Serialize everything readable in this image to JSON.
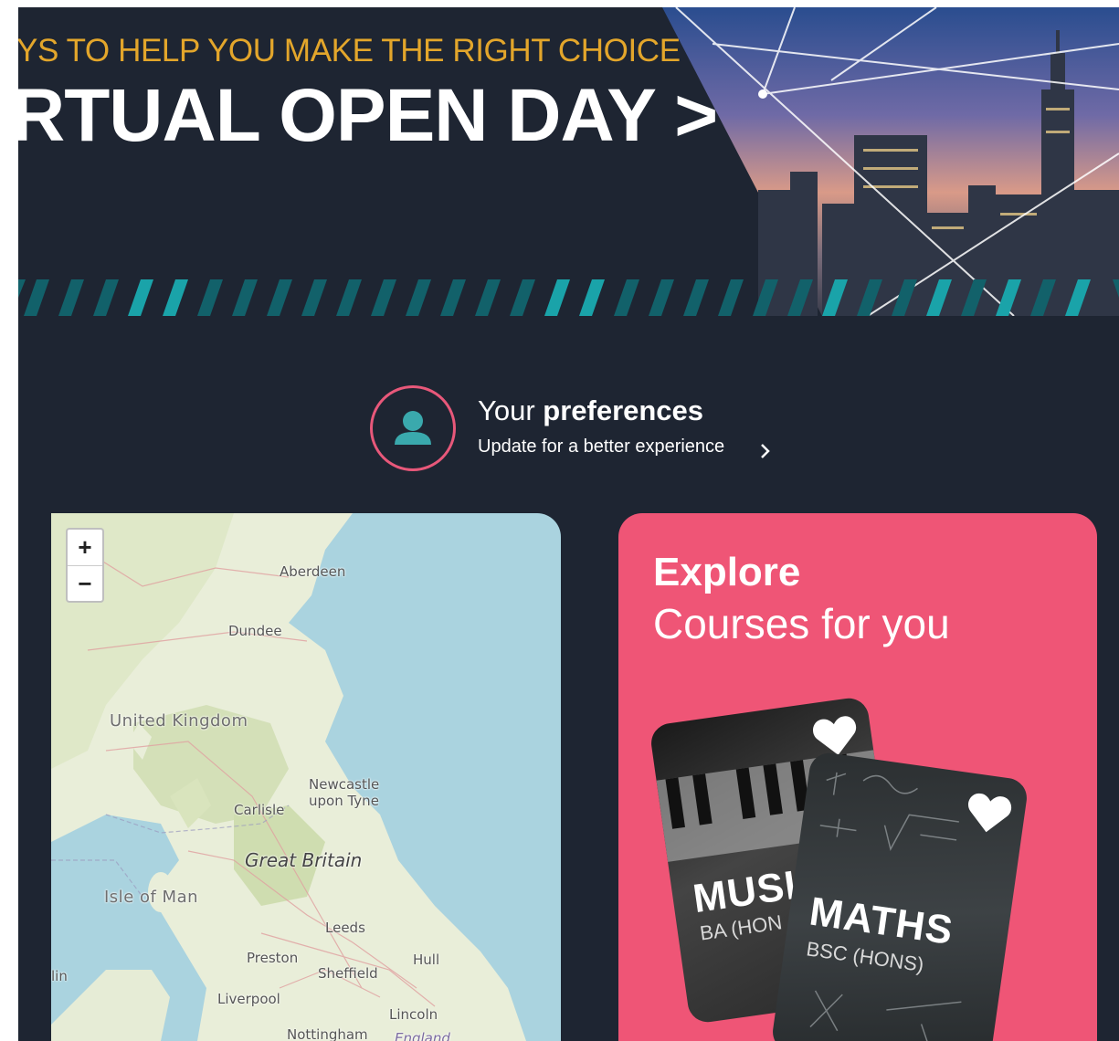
{
  "banner": {
    "tagline": "YS TO HELP YOU MAKE THE RIGHT CHOICE",
    "headline": "RTUAL OPEN DAY >"
  },
  "preferences": {
    "title_prefix": "Your",
    "title_bold": "preferences",
    "subtitle": "Update for a better experience"
  },
  "map": {
    "zoom_in": "+",
    "zoom_out": "−",
    "labels": {
      "aberdeen": "Aberdeen",
      "dundee": "Dundee",
      "united_kingdom": "United Kingdom",
      "newcastle_1": "Newcastle",
      "newcastle_2": "upon Tyne",
      "carlisle": "Carlisle",
      "great_britain": "Great Britain",
      "isle_of_man": "Isle of Man",
      "leeds": "Leeds",
      "preston": "Preston",
      "hull": "Hull",
      "sheffield": "Sheffield",
      "dublin_partial": "lin",
      "liverpool": "Liverpool",
      "lincoln": "Lincoln",
      "nottingham": "Nottingham",
      "england": "England"
    }
  },
  "explore": {
    "title": "Explore",
    "subtitle": "Courses for you",
    "cards": [
      {
        "name": "MUSI",
        "degree": "BA (HON"
      },
      {
        "name": "MATHS",
        "degree": "BSC (HONS)"
      }
    ]
  },
  "colors": {
    "dark_bg": "#1e2532",
    "accent_pink": "#ef5576",
    "tagline_gold": "#e3a62b",
    "teal": "#17a3a8"
  }
}
